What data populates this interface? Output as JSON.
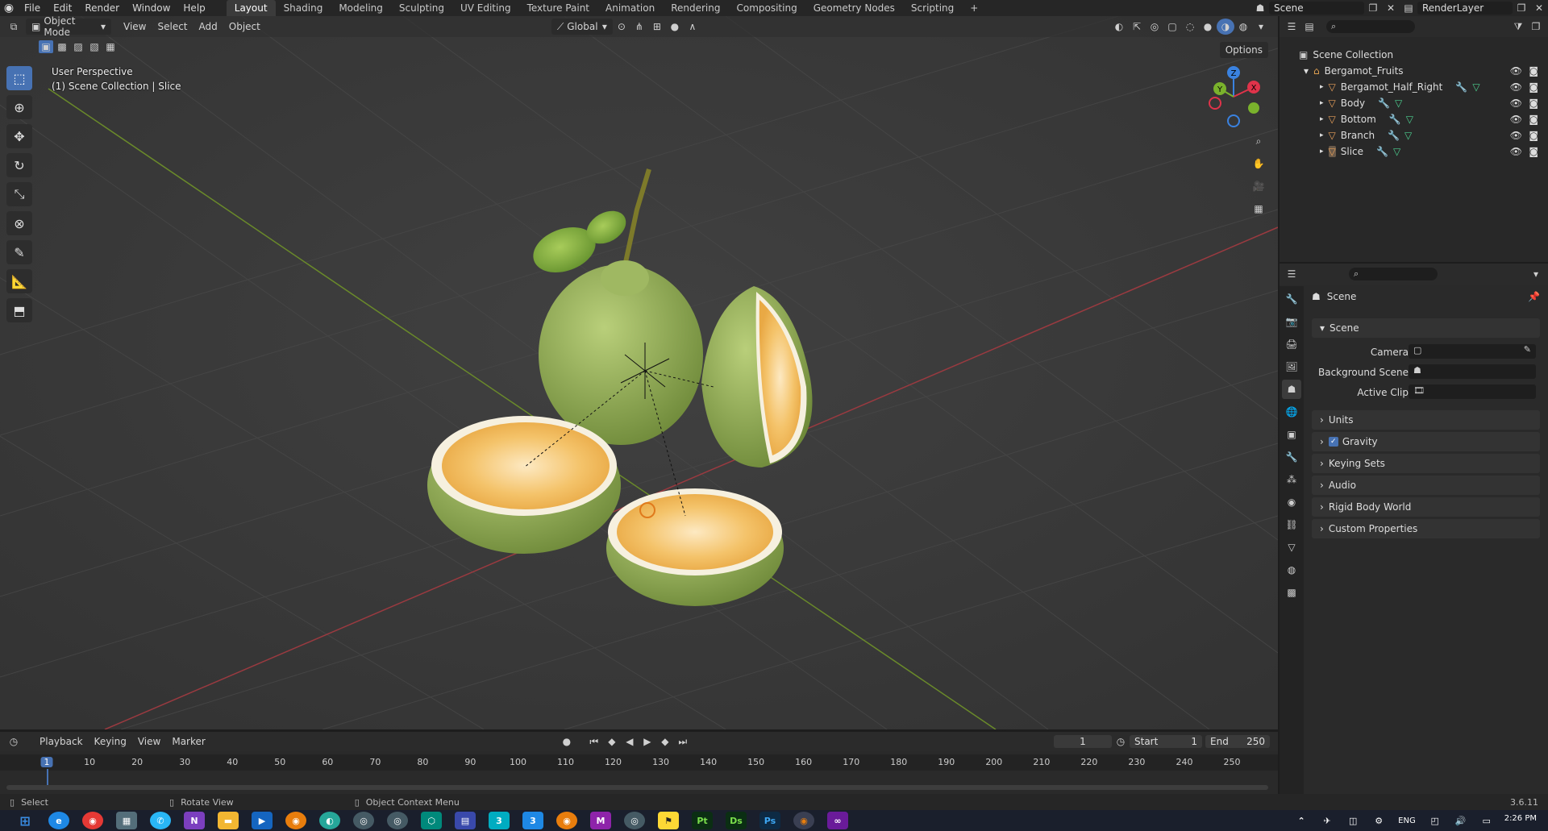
{
  "topbar": {
    "menus": [
      "File",
      "Edit",
      "Render",
      "Window",
      "Help"
    ],
    "workspaces": [
      "Layout",
      "Shading",
      "Modeling",
      "Sculpting",
      "UV Editing",
      "Texture Paint",
      "Animation",
      "Rendering",
      "Compositing",
      "Geometry Nodes",
      "Scripting"
    ],
    "active_workspace": "Layout",
    "add_tab": "+",
    "scene": "Scene",
    "view_layer": "RenderLayer"
  },
  "viewport": {
    "mode": "Object Mode",
    "menus": [
      "View",
      "Select",
      "Add",
      "Object"
    ],
    "transform": "Global",
    "options": "Options",
    "perspective": "User Perspective",
    "collection_info": "(1) Scene Collection | Slice",
    "gizmo": {
      "x": "X",
      "y": "Y",
      "z": "Z"
    }
  },
  "outliner": {
    "root": "Scene Collection",
    "collection": "Bergamot_Fruits",
    "objects": [
      "Bergamot_Half_Right",
      "Body",
      "Bottom",
      "Branch",
      "Slice"
    ]
  },
  "properties": {
    "header": "Scene",
    "section": "Scene",
    "fields": [
      {
        "label": "Camera"
      },
      {
        "label": "Background Scene"
      },
      {
        "label": "Active Clip"
      }
    ],
    "panels": [
      "Units",
      "Gravity",
      "Keying Sets",
      "Audio",
      "Rigid Body World",
      "Custom Properties"
    ]
  },
  "timeline": {
    "menus": [
      "Playback",
      "Keying",
      "View",
      "Marker"
    ],
    "current_frame": "1",
    "start_label": "Start",
    "start": "1",
    "end_label": "End",
    "end": "250",
    "ruler": [
      "1",
      "10",
      "20",
      "30",
      "40",
      "50",
      "60",
      "70",
      "80",
      "90",
      "100",
      "110",
      "120",
      "130",
      "140",
      "150",
      "160",
      "170",
      "180",
      "190",
      "200",
      "210",
      "220",
      "230",
      "240",
      "250"
    ]
  },
  "statusbar": {
    "select": "Select",
    "rotate": "Rotate View",
    "context": "Object Context Menu",
    "version": "3.6.11"
  },
  "taskbar": {
    "time": "2:26 PM",
    "lang": "ENG",
    "apps": [
      "N",
      "Pt",
      "Ds",
      "Ps"
    ]
  },
  "colors": {
    "accent": "#4772b3",
    "x_axis": "#e0334a",
    "y_axis": "#7ab22c",
    "z_axis": "#3a82e0"
  }
}
